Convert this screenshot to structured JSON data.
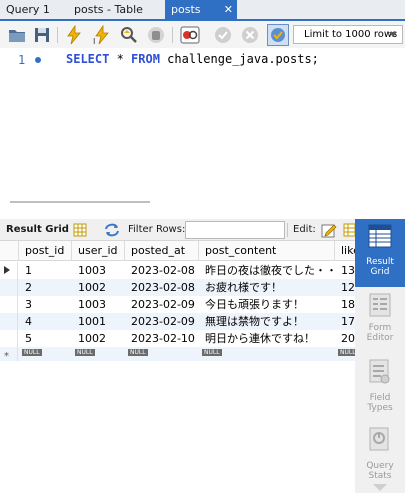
{
  "tabs": [
    {
      "label": "Query 1"
    },
    {
      "label": "posts - Table"
    },
    {
      "label": "posts"
    }
  ],
  "toolbar": {
    "limit_label": "Limit to 1000 rows"
  },
  "editor": {
    "line_number": "1",
    "sql": {
      "kw1": "SELECT",
      "star": " * ",
      "kw2": "FROM",
      "rest": " challenge_java.posts;"
    }
  },
  "result_toolbar": {
    "title": "Result Grid",
    "filter_label": "Filter Rows:",
    "edit_label": "Edit:"
  },
  "grid": {
    "columns": [
      "post_id",
      "user_id",
      "posted_at",
      "post_content",
      "like"
    ],
    "rows": [
      [
        "1",
        "1003",
        "2023-02-08",
        "昨日の夜は徹夜でした・・",
        "13"
      ],
      [
        "2",
        "1002",
        "2023-02-08",
        "お疲れ様です！",
        "12"
      ],
      [
        "3",
        "1003",
        "2023-02-09",
        "今日も頑張ります！",
        "18"
      ],
      [
        "4",
        "1001",
        "2023-02-09",
        "無理は禁物ですよ！",
        "17"
      ],
      [
        "5",
        "1002",
        "2023-02-10",
        "明日から連休ですね！",
        "20"
      ]
    ],
    "null_label": "NULL",
    "new_row_marker": "*"
  },
  "side_panel": {
    "items": [
      {
        "label_1": "Result",
        "label_2": "Grid",
        "icon": "result-grid-icon"
      },
      {
        "label_1": "Form",
        "label_2": "Editor",
        "icon": "form-editor-icon"
      },
      {
        "label_1": "Field",
        "label_2": "Types",
        "icon": "field-types-icon"
      },
      {
        "label_1": "Query",
        "label_2": "Stats",
        "icon": "query-stats-icon"
      }
    ]
  },
  "colors": {
    "accent": "#2f6fc4",
    "keyword": "#2f4fd6",
    "row_alt": "#eef4fc"
  }
}
